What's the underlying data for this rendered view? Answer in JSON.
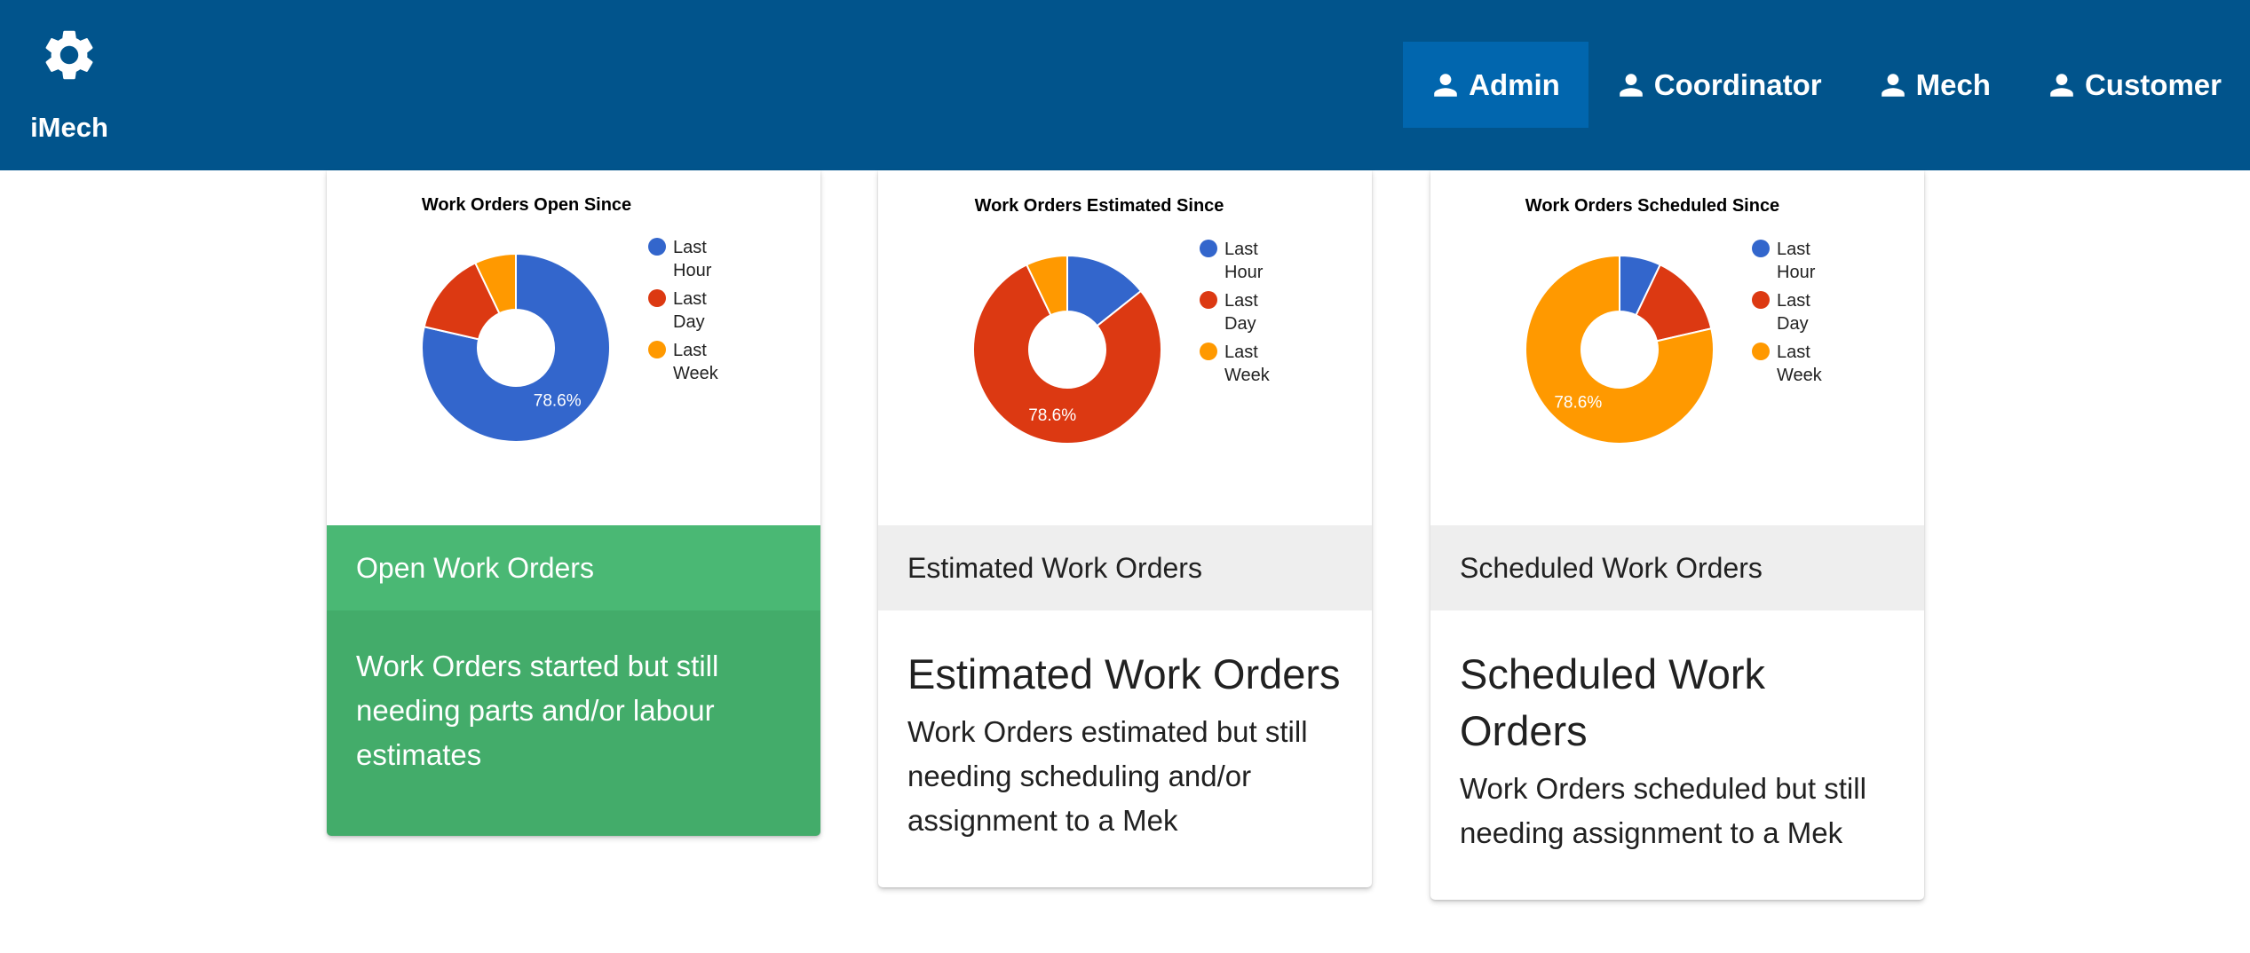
{
  "app": {
    "name": "iMech",
    "logo_icon": "gear-icon"
  },
  "nav": {
    "items": [
      {
        "label": "Admin",
        "icon": "user-icon",
        "active": true
      },
      {
        "label": "Coordinator",
        "icon": "user-icon",
        "active": false
      },
      {
        "label": "Mech",
        "icon": "user-icon",
        "active": false
      },
      {
        "label": "Customer",
        "icon": "user-icon",
        "active": false
      }
    ]
  },
  "colors": {
    "header_bg": "#01548c",
    "nav_active_bg": "#0166ae",
    "last_hour": "#3366cc",
    "last_day": "#dc3912",
    "last_week": "#ff9900",
    "open_card": "#43ac6a"
  },
  "cards": [
    {
      "header": "Open Work Orders",
      "body_title": "",
      "body_text": "Work Orders started but still needing parts and/or labour estimates"
    },
    {
      "header": "Estimated Work Orders",
      "body_title": "Estimated Work Orders",
      "body_text": "Work Orders estimated but still needing scheduling and/or assignment to a Mek"
    },
    {
      "header": "Scheduled Work Orders",
      "body_title": "Scheduled Work Orders",
      "body_text": "Work Orders scheduled but still needing assignment to a Mek"
    }
  ],
  "chart_data": [
    {
      "type": "pie",
      "donut": true,
      "title": "Work Orders Open Since",
      "legend_position": "right",
      "categories": [
        "Last Hour",
        "Last Day",
        "Last Week"
      ],
      "values": [
        78.6,
        14.3,
        7.1
      ],
      "colors": [
        "#3366cc",
        "#dc3912",
        "#ff9900"
      ],
      "visible_labels": [
        "78.6%",
        "",
        ""
      ]
    },
    {
      "type": "pie",
      "donut": true,
      "title": "Work Orders Estimated Since",
      "legend_position": "right",
      "categories": [
        "Last Hour",
        "Last Day",
        "Last Week"
      ],
      "values": [
        14.3,
        78.6,
        7.1
      ],
      "colors": [
        "#3366cc",
        "#dc3912",
        "#ff9900"
      ],
      "visible_labels": [
        "",
        "78.6%",
        ""
      ]
    },
    {
      "type": "pie",
      "donut": true,
      "title": "Work Orders Scheduled Since",
      "legend_position": "right",
      "categories": [
        "Last Hour",
        "Last Day",
        "Last Week"
      ],
      "values": [
        7.1,
        14.3,
        78.6
      ],
      "colors": [
        "#3366cc",
        "#dc3912",
        "#ff9900"
      ],
      "visible_labels": [
        "",
        "",
        "78.6%"
      ]
    }
  ]
}
